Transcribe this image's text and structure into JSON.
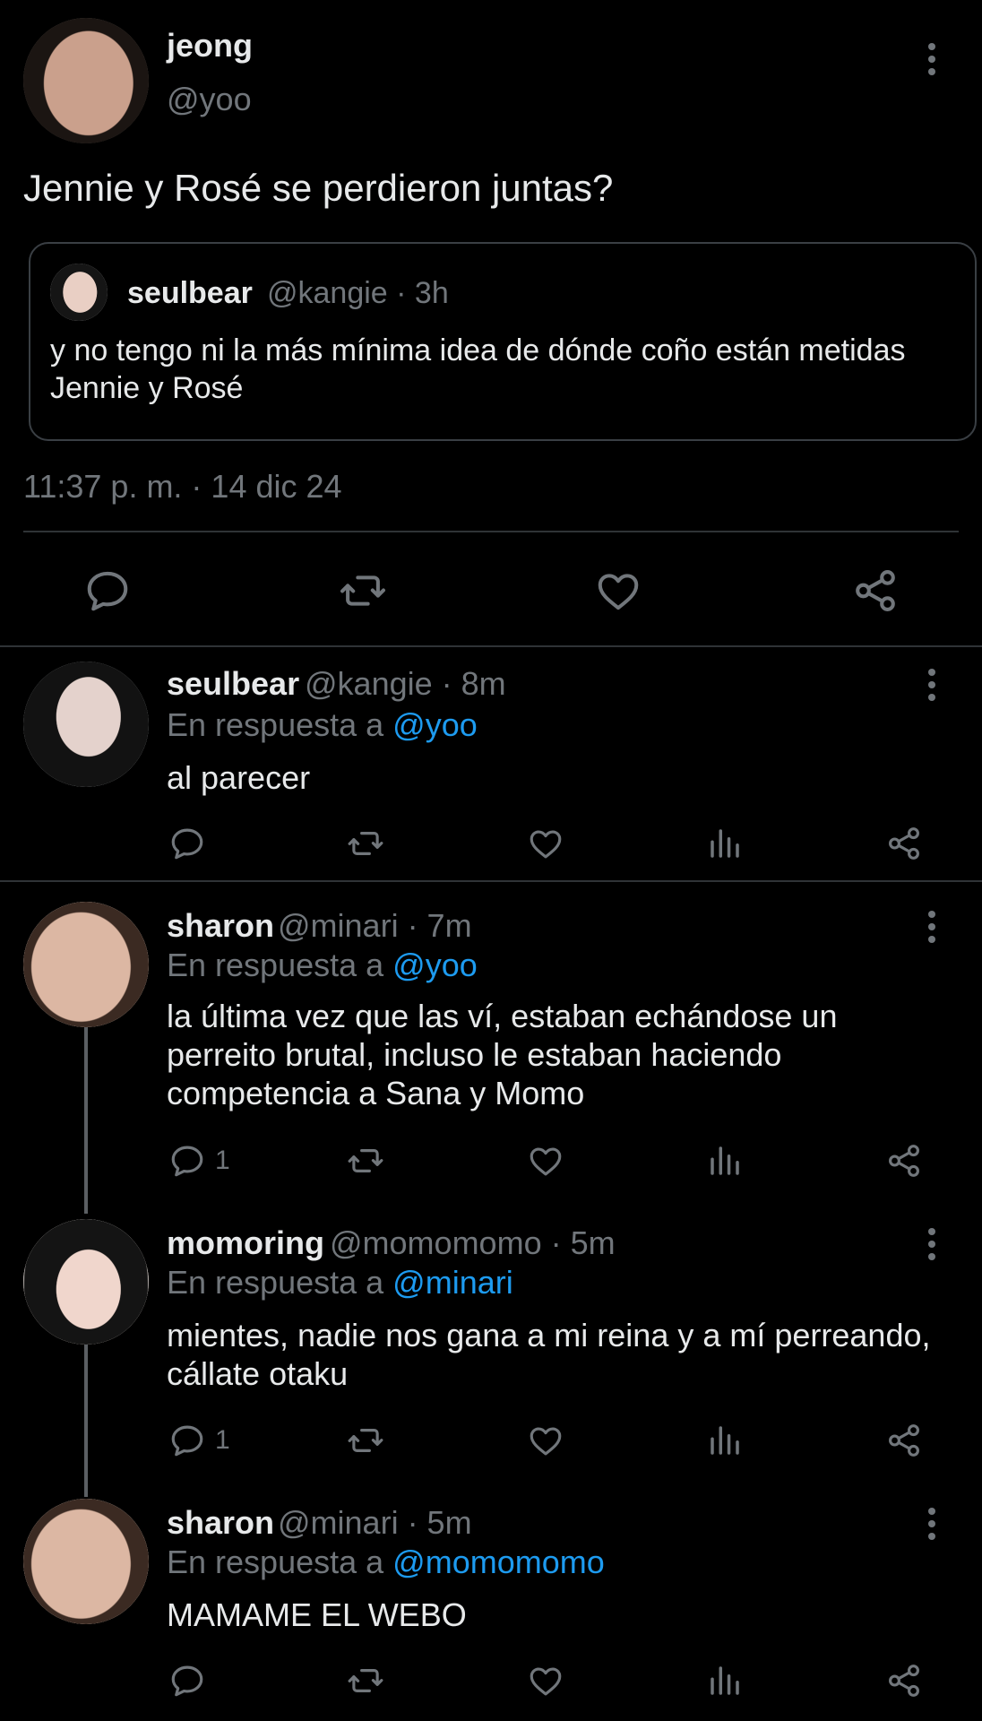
{
  "main_tweet": {
    "name": "jeong",
    "handle": "@yoo",
    "text": "Jennie y Rosé se perdieron juntas?",
    "quote": {
      "name": "seulbear",
      "meta": "@kangie · 3h",
      "text": "y no tengo ni la más mínima idea de dónde coño están metidas Jennie y Rosé"
    },
    "timestamp": "11:37 p. m. · 14 dic 24"
  },
  "reply_prefix": "En respuesta a ",
  "replies": [
    {
      "name": "seulbear",
      "meta": "@kangie · 8m",
      "reply_to": "@yoo",
      "text": "al parecer",
      "reply_count": ""
    },
    {
      "name": "sharon",
      "meta": "@minari · 7m",
      "reply_to": "@yoo",
      "text": "la última vez que las ví, estaban echándose un perreito brutal, incluso le estaban haciendo competencia a Sana y Momo",
      "reply_count": "1"
    },
    {
      "name": "momoring",
      "meta": "@momomomo · 5m",
      "reply_to": "@minari",
      "text": "mientes, nadie nos gana a mi reina y a mí perreando, cállate otaku",
      "reply_count": "1"
    },
    {
      "name": "sharon",
      "meta": "@minari · 5m",
      "reply_to": "@momomomo",
      "text": "MAMAME EL WEBO",
      "reply_count": ""
    }
  ],
  "icons": [
    "reply-icon",
    "retweet-icon",
    "like-icon",
    "views-icon",
    "share-icon",
    "more-icon"
  ],
  "colors": {
    "background": "#000000",
    "text": "#e7e9ea",
    "muted": "#71767b",
    "link": "#1d9bf0",
    "divider": "#2f3336"
  }
}
